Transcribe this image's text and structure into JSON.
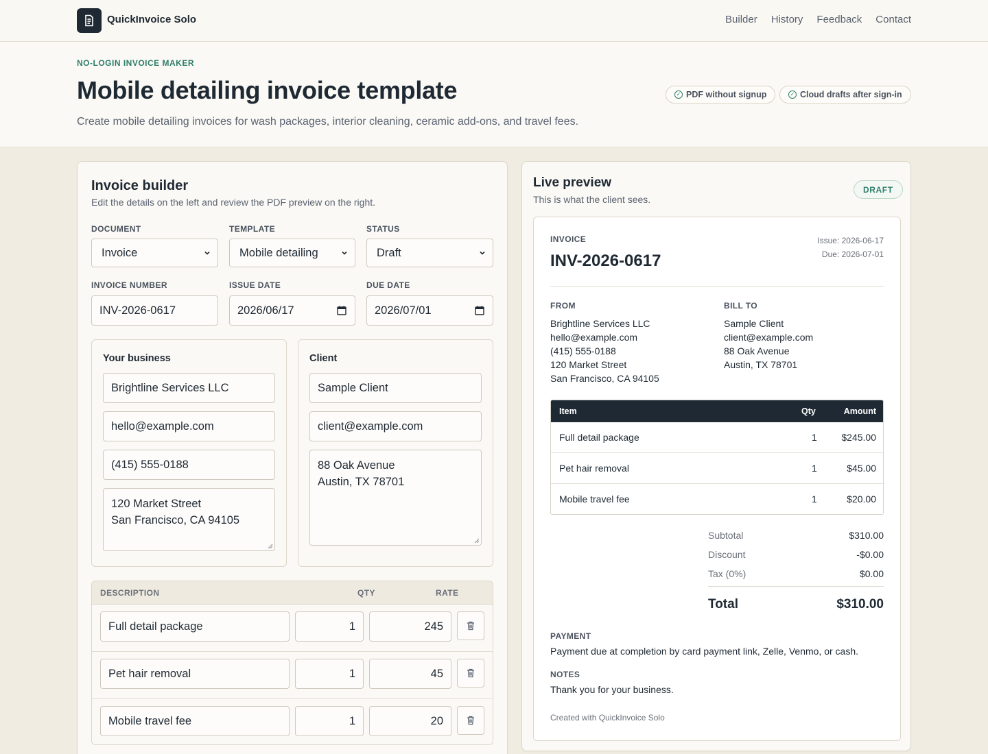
{
  "nav": {
    "brand": "QuickInvoice Solo",
    "links": [
      "Builder",
      "History",
      "Feedback",
      "Contact"
    ]
  },
  "hero": {
    "eyebrow": "NO-LOGIN INVOICE MAKER",
    "title": "Mobile detailing invoice template",
    "subtitle": "Create mobile detailing invoices for wash packages, interior cleaning, ceramic add-ons, and travel fees.",
    "pills": [
      "PDF without signup",
      "Cloud drafts after sign-in"
    ]
  },
  "builder": {
    "title": "Invoice builder",
    "subtitle": "Edit the details on the left and review the PDF preview on the right.",
    "fields": {
      "document_label": "DOCUMENT",
      "document_value": "Invoice",
      "template_label": "TEMPLATE",
      "template_value": "Mobile detailing",
      "status_label": "STATUS",
      "status_value": "Draft",
      "invoice_number_label": "INVOICE NUMBER",
      "invoice_number_value": "INV-2026-0617",
      "issue_date_label": "ISSUE DATE",
      "issue_date_value": "2026/06/17",
      "due_date_label": "DUE DATE",
      "due_date_value": "2026/07/01"
    },
    "business": {
      "title": "Your business",
      "name": "Brightline Services LLC",
      "email": "hello@example.com",
      "phone": "(415) 555-0188",
      "address": "120 Market Street\nSan Francisco, CA 94105"
    },
    "client": {
      "title": "Client",
      "name": "Sample Client",
      "email": "client@example.com",
      "address": "88 Oak Avenue\nAustin, TX 78701"
    },
    "items_header": {
      "description": "DESCRIPTION",
      "qty": "QTY",
      "rate": "RATE"
    },
    "items": [
      {
        "description": "Full detail package",
        "qty": "1",
        "rate": "245"
      },
      {
        "description": "Pet hair removal",
        "qty": "1",
        "rate": "45"
      },
      {
        "description": "Mobile travel fee",
        "qty": "1",
        "rate": "20"
      }
    ]
  },
  "preview": {
    "title": "Live preview",
    "subtitle": "This is what the client sees.",
    "badge": "DRAFT",
    "doc_label": "INVOICE",
    "invoice_number": "INV-2026-0617",
    "issue": "Issue: 2026-06-17",
    "due": "Due: 2026-07-01",
    "from_label": "FROM",
    "from_lines": [
      "Brightline Services LLC",
      "hello@example.com",
      "(415) 555-0188",
      "120 Market Street",
      "San Francisco, CA 94105"
    ],
    "bill_to_label": "BILL TO",
    "bill_to_lines": [
      "Sample Client",
      "client@example.com",
      "88 Oak Avenue",
      "Austin, TX 78701"
    ],
    "table_header": {
      "item": "Item",
      "qty": "Qty",
      "amount": "Amount"
    },
    "rows": [
      {
        "item": "Full detail package",
        "qty": "1",
        "amount": "$245.00"
      },
      {
        "item": "Pet hair removal",
        "qty": "1",
        "amount": "$45.00"
      },
      {
        "item": "Mobile travel fee",
        "qty": "1",
        "amount": "$20.00"
      }
    ],
    "subtotal_label": "Subtotal",
    "subtotal": "$310.00",
    "discount_label": "Discount",
    "discount": "-$0.00",
    "tax_label": "Tax (0%)",
    "tax": "$0.00",
    "total_label": "Total",
    "total": "$310.00",
    "payment_label": "PAYMENT",
    "payment_text": "Payment due at completion by card payment link, Zelle, Venmo, or cash.",
    "notes_label": "NOTES",
    "notes_text": "Thank you for your business.",
    "footer": "Created with QuickInvoice Solo"
  },
  "colors": {
    "accent": "#2e7d6a",
    "dark": "#1f2933",
    "page_bg": "#f1ece2"
  }
}
